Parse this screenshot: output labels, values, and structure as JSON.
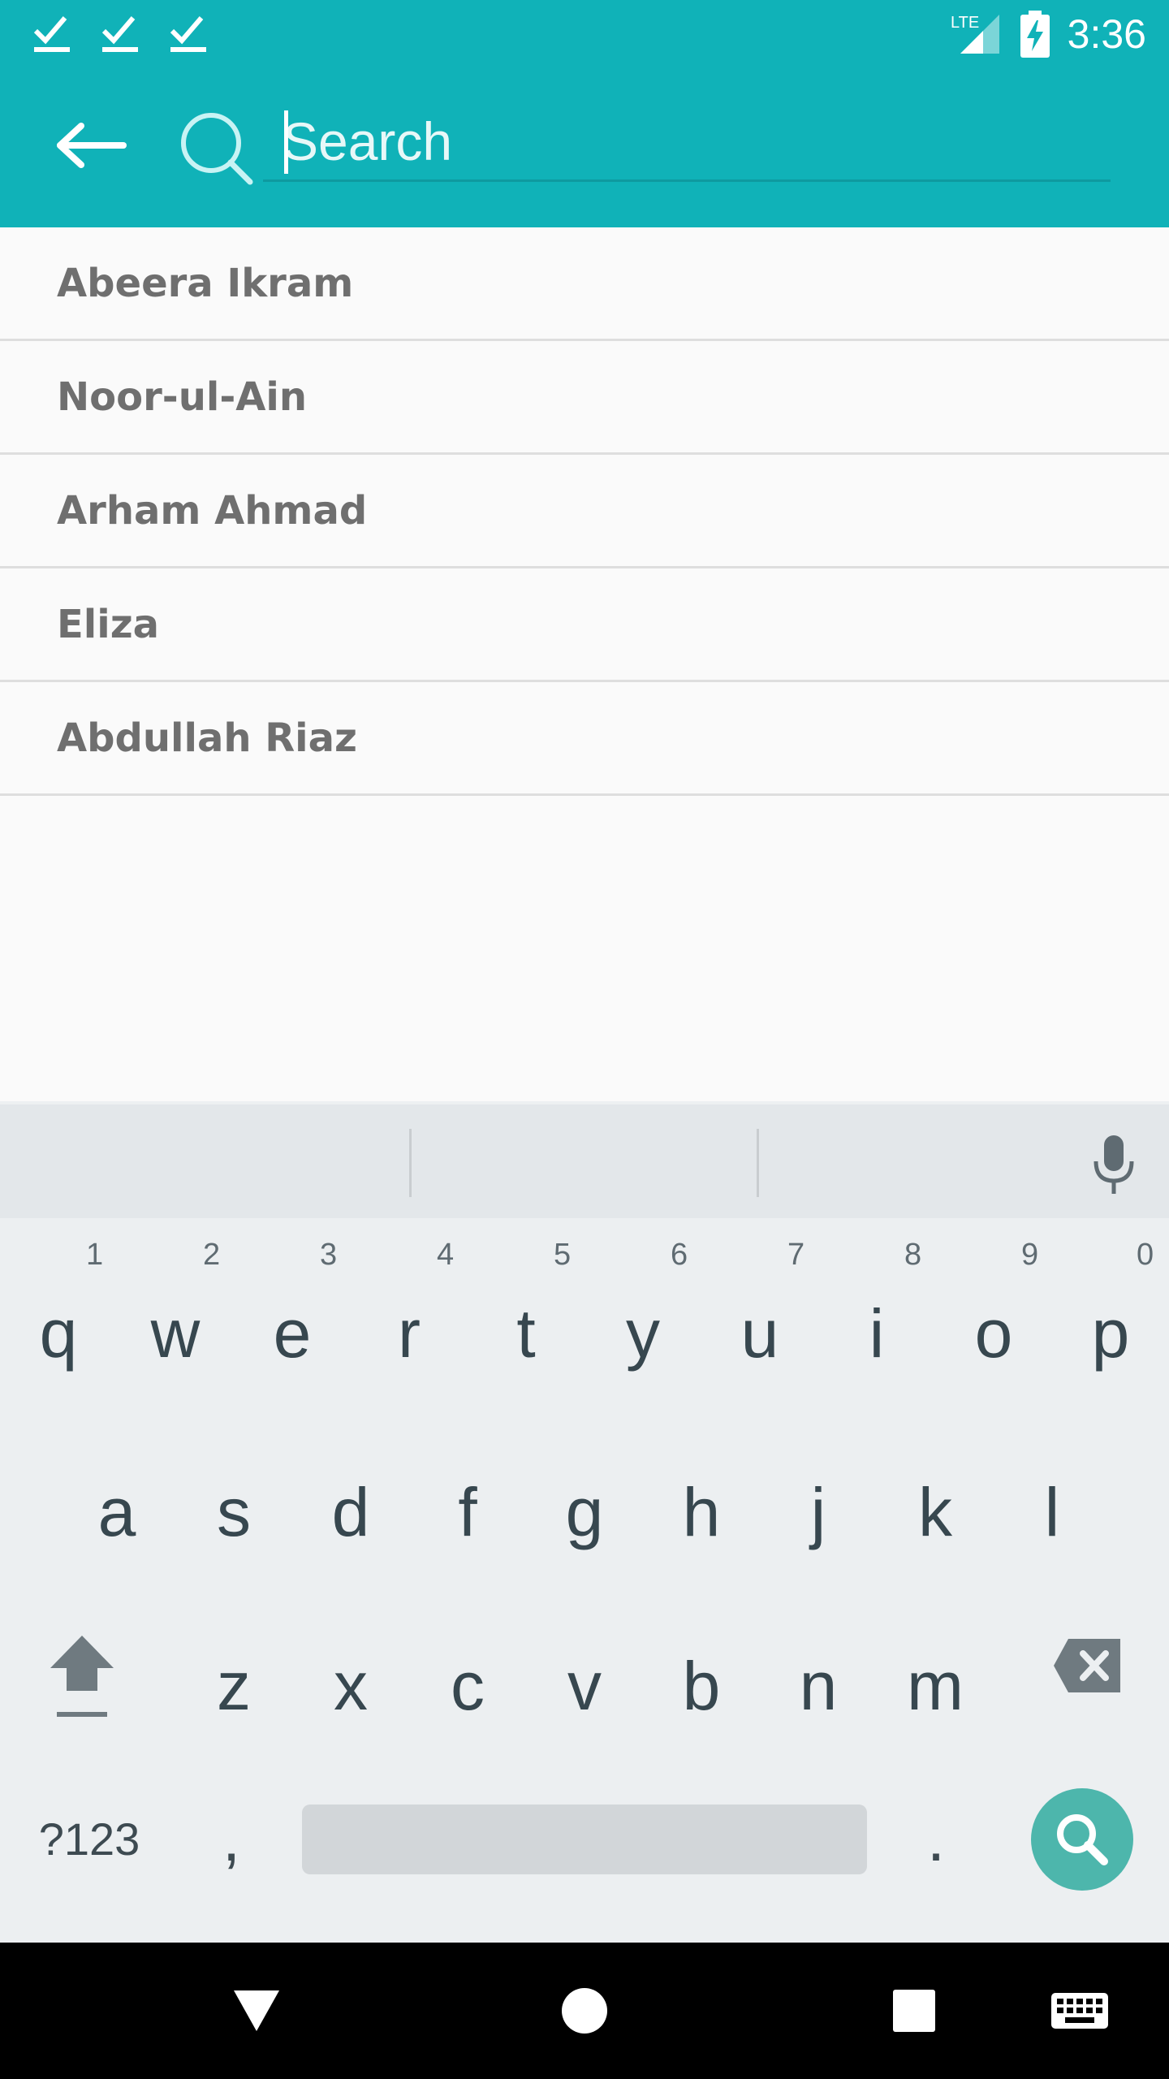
{
  "status_bar": {
    "time": "3:36",
    "network": "LTE",
    "notification_icons": [
      "check-icon",
      "check-icon",
      "check-icon"
    ],
    "battery": "charging"
  },
  "search": {
    "placeholder": "Search",
    "value": ""
  },
  "results": [
    {
      "name": "Abeera Ikram"
    },
    {
      "name": "Noor-ul-Ain"
    },
    {
      "name": "Arham Ahmad"
    },
    {
      "name": "Eliza"
    },
    {
      "name": "Abdullah Riaz"
    }
  ],
  "keyboard": {
    "row1": [
      {
        "key": "q",
        "hint": "1"
      },
      {
        "key": "w",
        "hint": "2"
      },
      {
        "key": "e",
        "hint": "3"
      },
      {
        "key": "r",
        "hint": "4"
      },
      {
        "key": "t",
        "hint": "5"
      },
      {
        "key": "y",
        "hint": "6"
      },
      {
        "key": "u",
        "hint": "7"
      },
      {
        "key": "i",
        "hint": "8"
      },
      {
        "key": "o",
        "hint": "9"
      },
      {
        "key": "p",
        "hint": "0"
      }
    ],
    "row2": [
      "a",
      "s",
      "d",
      "f",
      "g",
      "h",
      "j",
      "k",
      "l"
    ],
    "row3": [
      "z",
      "x",
      "c",
      "v",
      "b",
      "n",
      "m"
    ],
    "symbols_label": "?123",
    "comma": ",",
    "period": "."
  },
  "colors": {
    "app_bar": "#10b2b8",
    "keyboard_bg": "#eceff1",
    "action_key": "#4db6ac"
  }
}
